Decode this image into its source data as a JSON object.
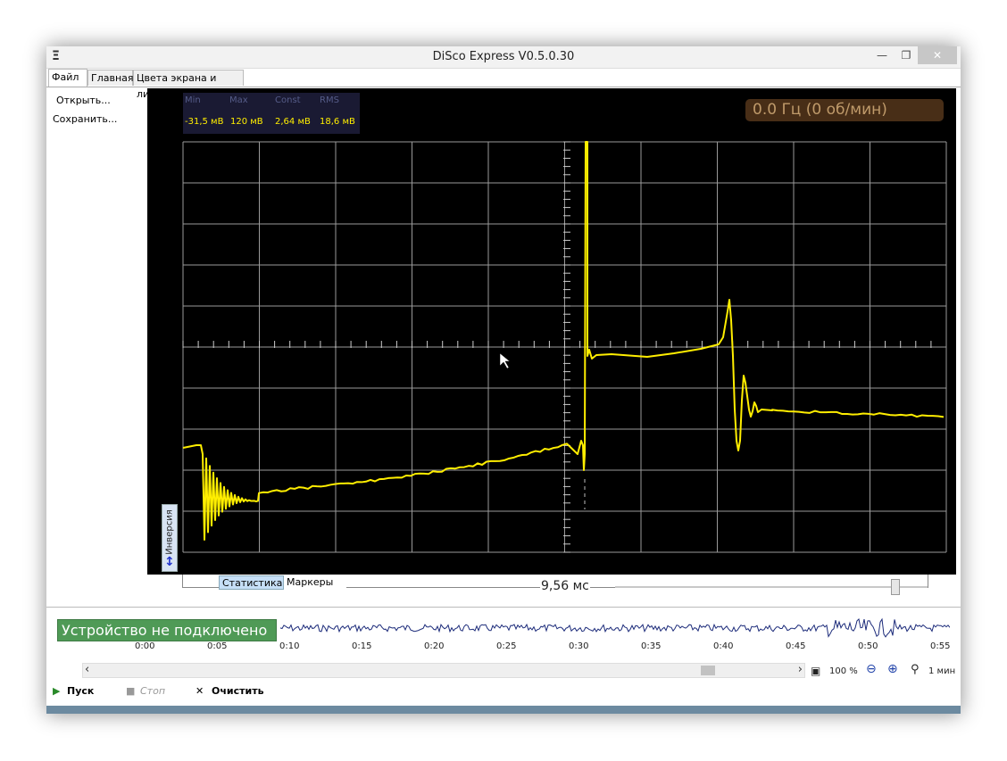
{
  "window": {
    "title": "DiSco Express V0.5.0.30",
    "min_glyph": "—",
    "max_glyph": "❐",
    "close_glyph": "✕"
  },
  "menu_tabs": [
    "Файл",
    "Главная",
    "Цвета экрана и линий"
  ],
  "file_menu": [
    "Открыть...",
    "Сохранить..."
  ],
  "stats": {
    "headers": [
      "Min",
      "Max",
      "Const",
      "RMS"
    ],
    "values": [
      "-31,5 мВ",
      "120 мВ",
      "2,64 мВ",
      "18,6 мВ"
    ]
  },
  "frequency": "0.0 Гц (0 об/мин)",
  "inversion_label": "Инверсия",
  "bottom_tabs": [
    "Статистика",
    "Маркеры"
  ],
  "time_per_div": "9,56 мс",
  "status": "Устройство не подключено",
  "timeline_ticks": [
    "0:00",
    "0:05",
    "0:10",
    "0:15",
    "0:20",
    "0:25",
    "0:30",
    "0:35",
    "0:40",
    "0:45",
    "0:50",
    "0:55"
  ],
  "zoom": {
    "percent": "100 %",
    "duration": "1 мин"
  },
  "toolbar": {
    "start": "Пуск",
    "stop": "Стоп",
    "clear": "Очистить"
  },
  "colors": {
    "trace": "#ffee00",
    "grid": "#9a9a9a",
    "background": "#000000",
    "overview_trace": "#1c2b7a"
  }
}
